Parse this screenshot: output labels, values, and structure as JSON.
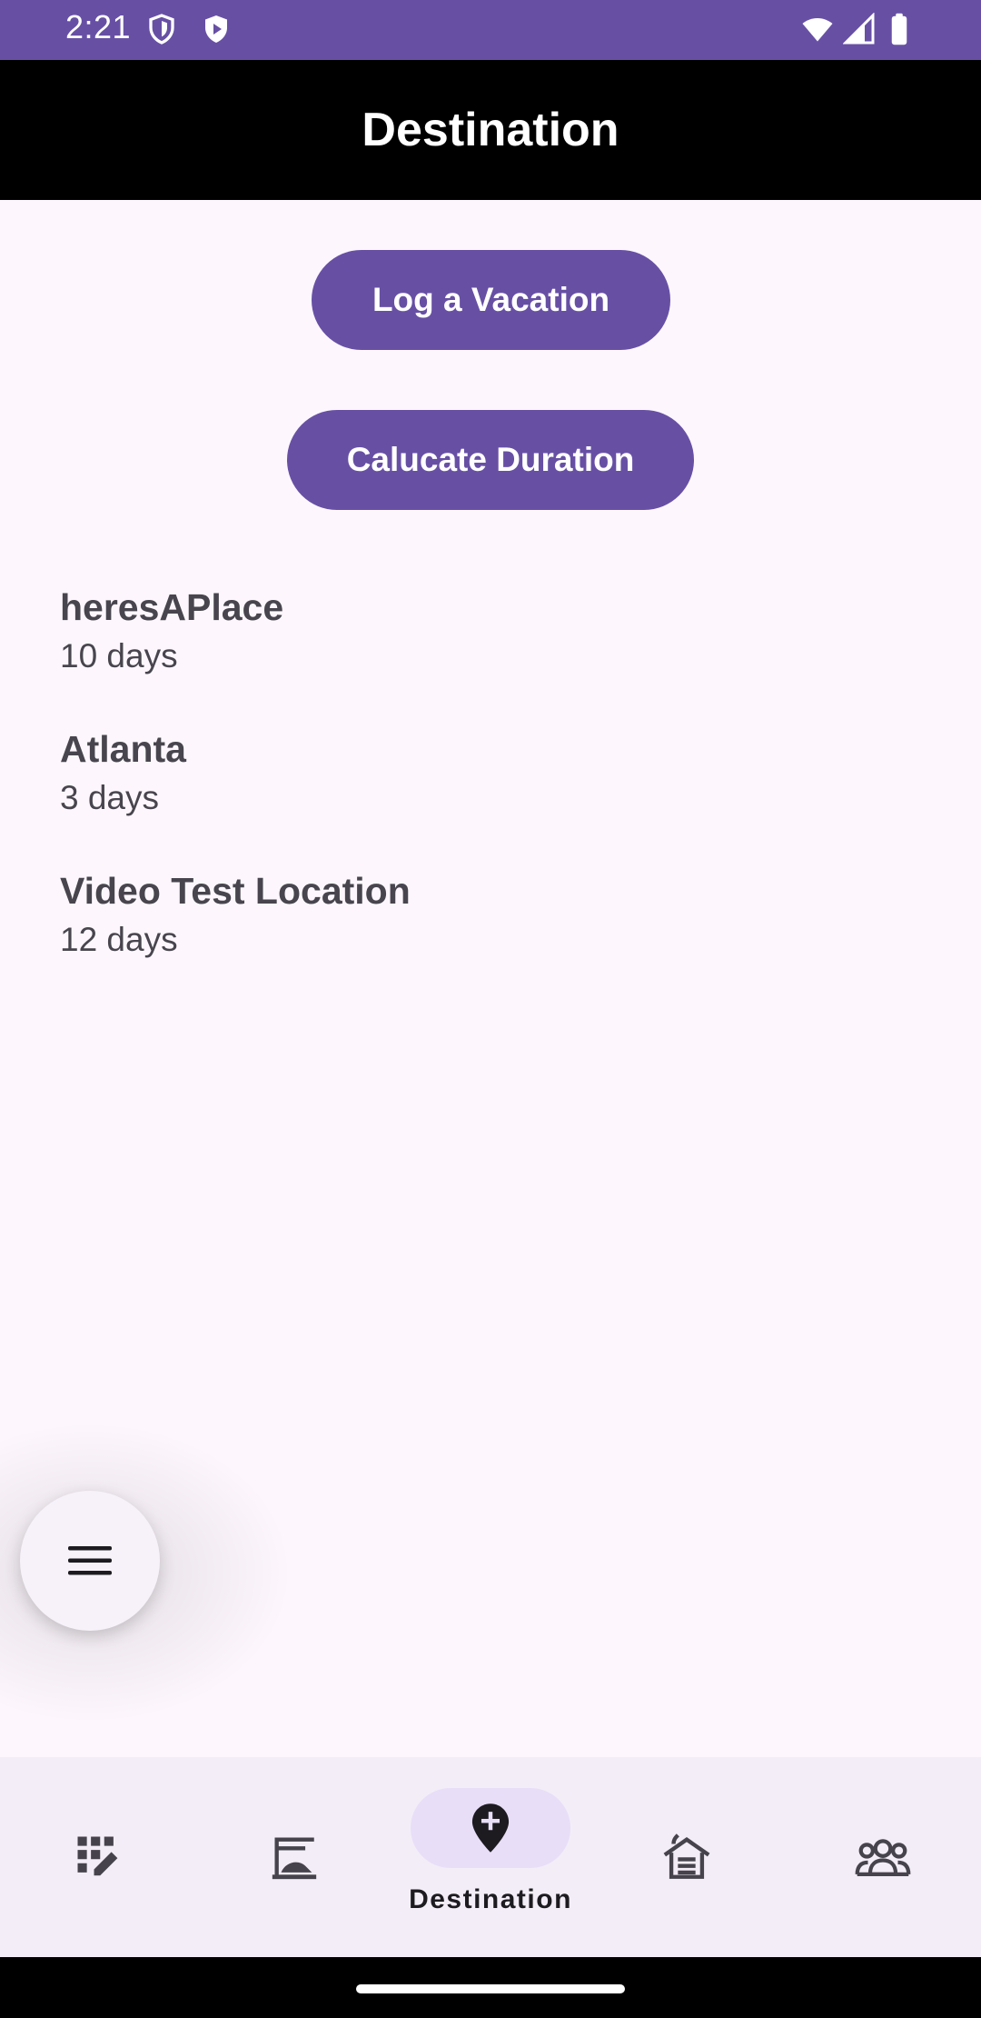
{
  "status_bar": {
    "time": "2:21",
    "icons": [
      "shield-icon",
      "play-shield-icon",
      "wifi-icon",
      "signal-icon",
      "battery-icon"
    ]
  },
  "toolbar": {
    "title": "Destination"
  },
  "actions": {
    "log_label": "Log a Vacation",
    "calc_label": "Calucate Duration"
  },
  "trips": [
    {
      "name": "heresAPlace",
      "duration": "10 days"
    },
    {
      "name": "Atlanta",
      "duration": "3 days"
    },
    {
      "name": "Video Test Location",
      "duration": "12 days"
    }
  ],
  "fab": {
    "icon": "menu-icon"
  },
  "bottom_nav": {
    "items": [
      {
        "icon": "planner-edit-icon",
        "label": ""
      },
      {
        "icon": "beach-icon",
        "label": ""
      },
      {
        "icon": "add-location-icon",
        "label": "Destination",
        "active": true
      },
      {
        "icon": "cabin-icon",
        "label": ""
      },
      {
        "icon": "group-icon",
        "label": ""
      }
    ]
  },
  "colors": {
    "primary": "#6750a4",
    "background": "#fdf7fd",
    "nav_background": "#f3edf7",
    "nav_active_indicator": "#e8def8",
    "text": "#48454e"
  }
}
